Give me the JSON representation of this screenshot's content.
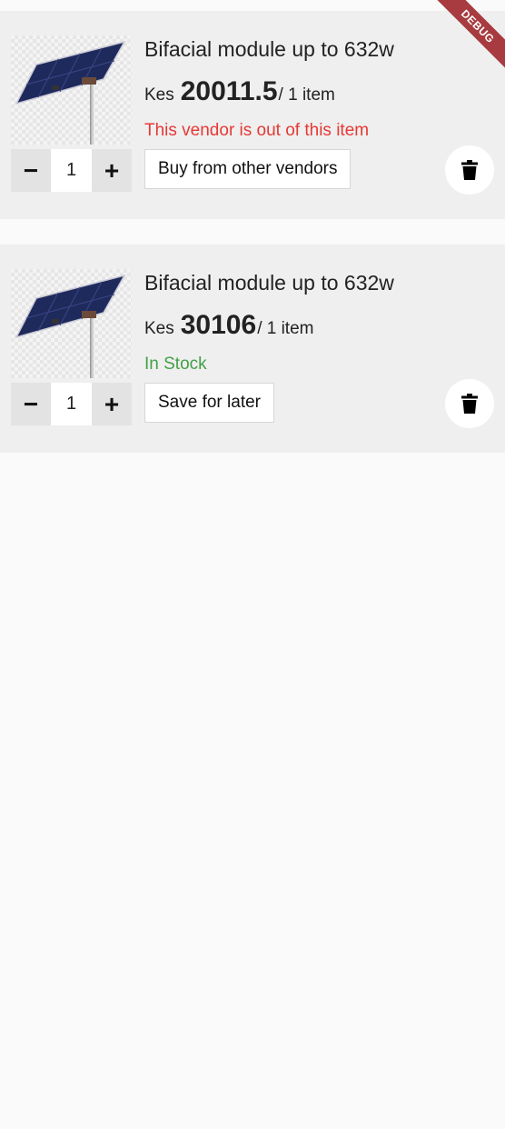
{
  "debug_banner": {
    "label": "DEBUG"
  },
  "cart": {
    "items": [
      {
        "title": "Bifacial module up to 632w",
        "currency": "Kes",
        "price": "20011.5",
        "per_unit": "/ 1 item",
        "status": "This vendor is out of this item",
        "status_type": "out_of_stock",
        "status_color": "#e53935",
        "quantity": "1",
        "decrement": "−",
        "increment": "+",
        "action_label": "Buy from other vendors",
        "delete_icon": "trash-icon"
      },
      {
        "title": "Bifacial module up to 632w",
        "currency": "Kes",
        "price": "30106",
        "per_unit": "/ 1 item",
        "status": "In Stock",
        "status_type": "in_stock",
        "status_color": "#43a047",
        "quantity": "1",
        "decrement": "−",
        "increment": "+",
        "action_label": "Save for later",
        "delete_icon": "trash-icon"
      }
    ]
  }
}
